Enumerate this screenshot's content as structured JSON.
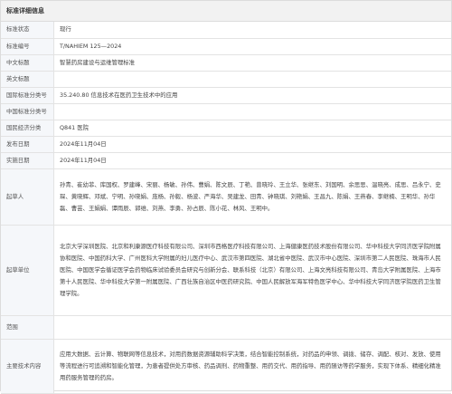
{
  "header": {
    "title": "标准详细信息"
  },
  "rows": [
    {
      "key": "标准状态",
      "value": "现行"
    },
    {
      "key": "标准编号",
      "value": "T/NAHIEM 125—2024"
    },
    {
      "key": "中文标题",
      "value": "智慧药房建设与运维管理标准"
    },
    {
      "key": "英文标题",
      "value": ""
    },
    {
      "key": "国际标准分类号",
      "value": "35.240.80 信息技术在医药卫生技术中的应用"
    },
    {
      "key": "中国标准分类号",
      "value": ""
    },
    {
      "key": "国民经济分类",
      "value": "Q841 医院"
    },
    {
      "key": "发布日期",
      "value": "2024年11月04日"
    },
    {
      "key": "实施日期",
      "value": "2024年11月04日"
    },
    {
      "key": "起草人",
      "value": "孙青、崔幼菲、库国权、罗建峰、宋丽、杨敏、孙伟、曹娟、陈文辰、丁艳、曾晓玲、王立华、张继东、刘国明、余思思、温晓亮、成思、吕永宁、史琛、黄晓辉、邓斌、宁明、孙晓娟、庞杨、孙毅、杨波、严海华、吴建龙、田青、钟晓琪、刘艳娟、王昌九、陈娟、王燕春、李继楠、王明华、孙华磊、曹芸、王娟娟、谭雨辰、郭维、刘燕、李勇、孙占辰、陈小花、林风、王明中。"
    },
    {
      "key": "起草单位",
      "value": "北京大学深圳医院、北京和利康源医疗科技有限公司、深圳市西格医疗科技有限公司、上海健康医药技术股份有限公司、华中科技大学同济医学院附属协和医院、中国药科大学、广州医科大学附属的妇儿医疗中心、武汉市第四医院、湖北省中医院、武汉市中心医院、深圳市第二人民医院、珠海市人民医院、中国医学会循证医学会药物临床试验委员会研究与创新分会、联系科技（北京）有限公司、上海文亮科技有限公司、青岛大学附属医院、上海市第十人民医院、华中科技大学第一附属医院、广西壮族自治区中医药研究院、中国人民解放军海军特色医学中心、华中科技大学同济医学院医药卫生管理学院。"
    },
    {
      "key": "范围",
      "value": ""
    },
    {
      "key": "主要技术内容",
      "value": "应用大数据、云计算、物联网等信息技术，对用药数据资源辅助科学决策，结合智能控制系统，对药品的申领、调拨、储存、调配、核对、发放、使用等流程进行可追溯和智能化管理，为患者提供处方审核、药品调剂、药物重整、用药交代、用药指导、用药随访等药学服务，实现下体系、精细化精准用药服务管理的药房。"
    }
  ]
}
